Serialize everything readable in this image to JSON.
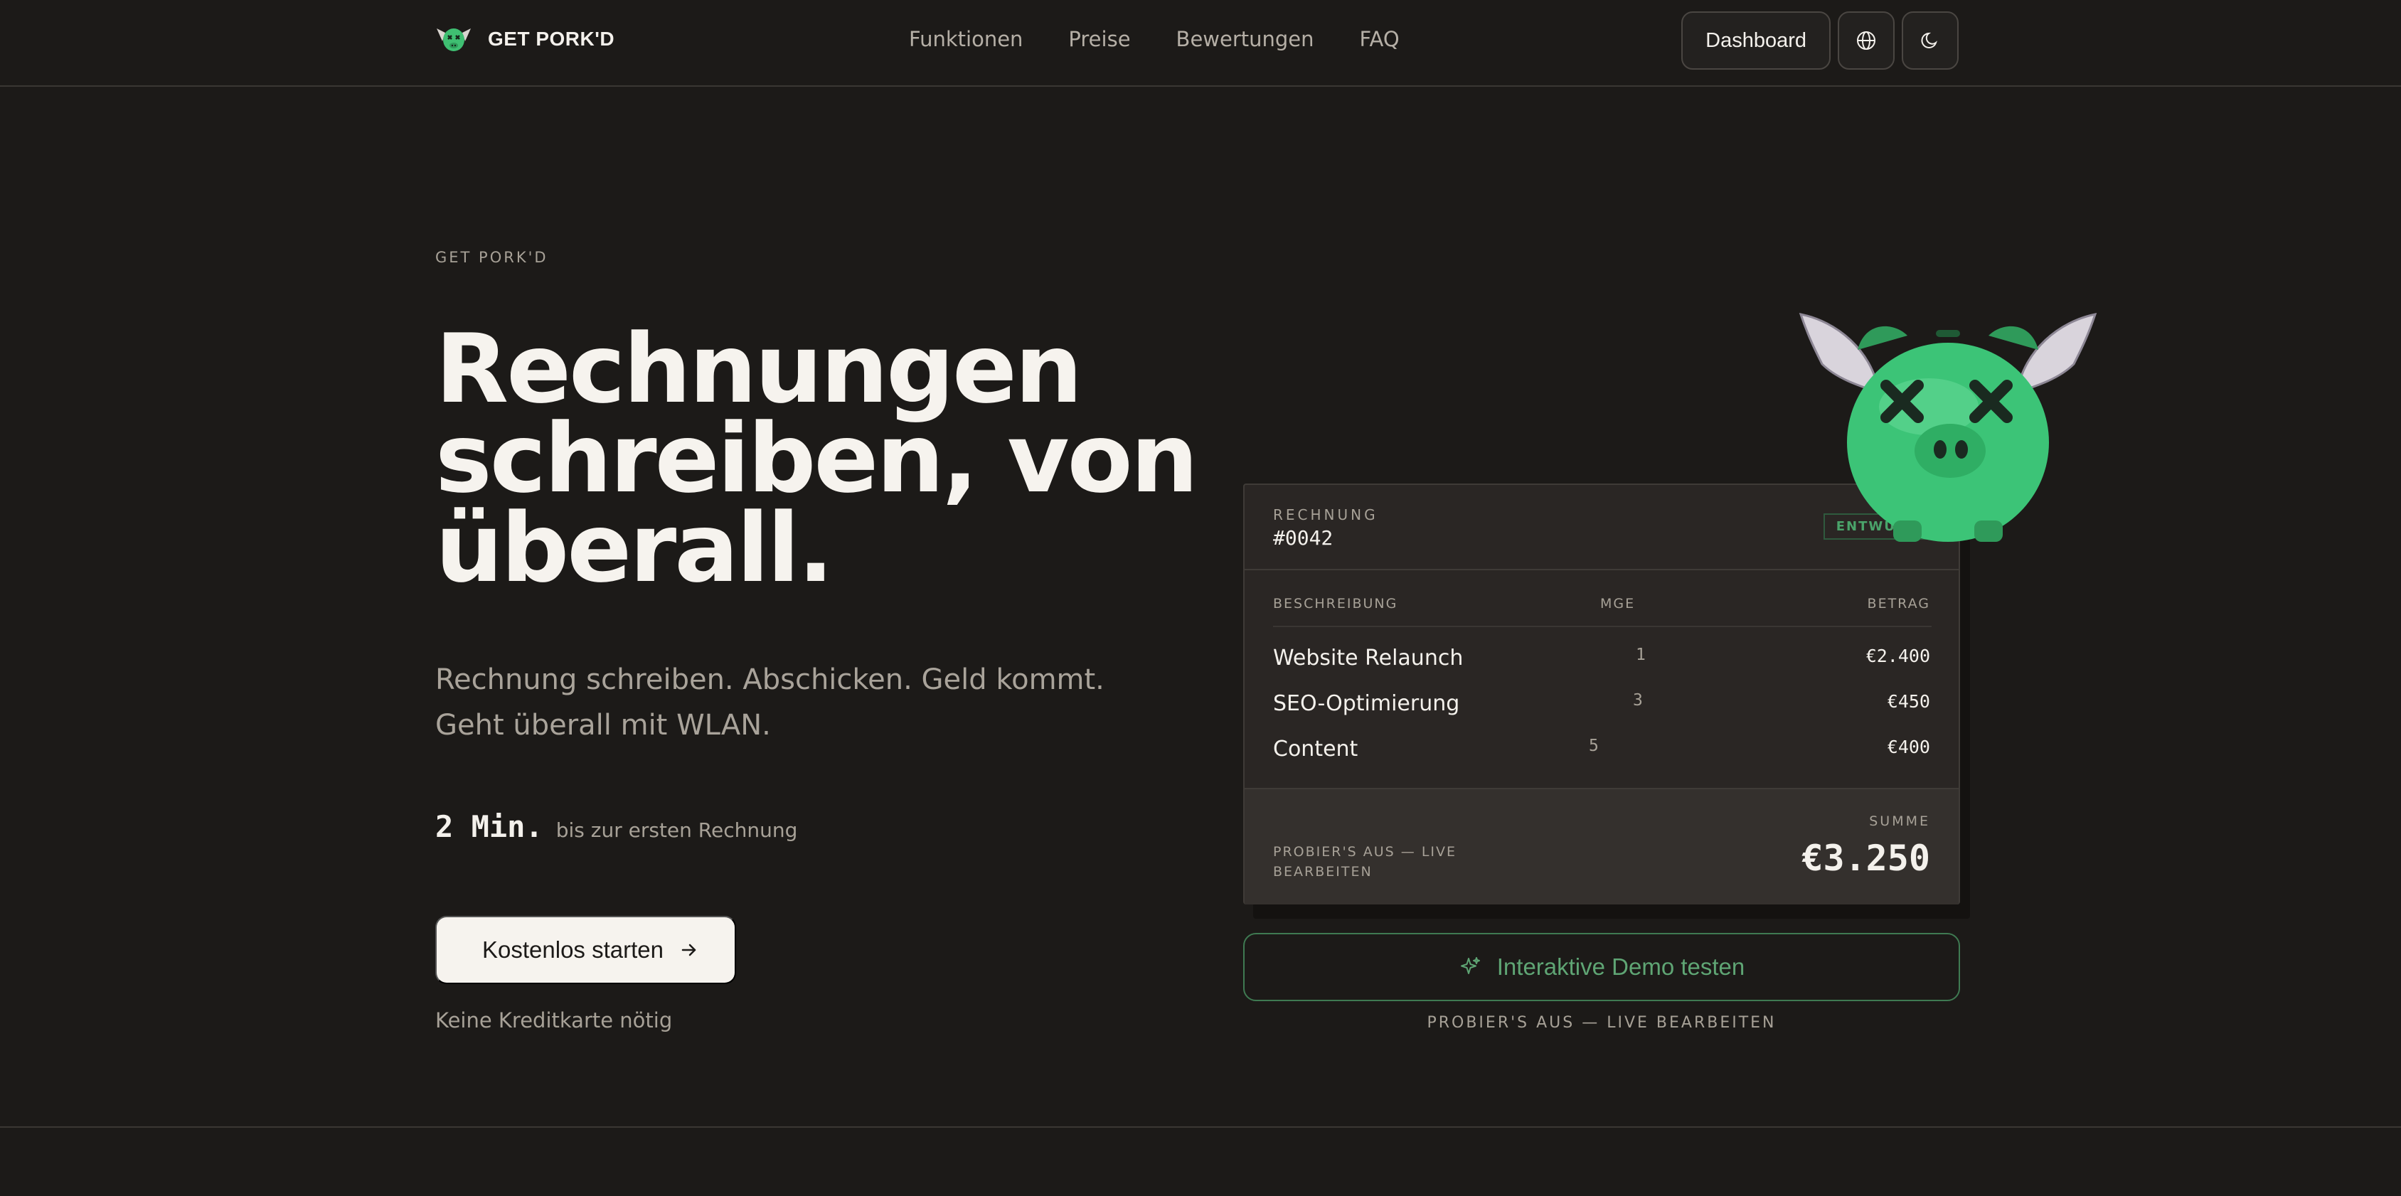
{
  "brand": {
    "name": "GET PORK'D"
  },
  "nav": {
    "links": [
      "Funktionen",
      "Preise",
      "Bewertungen",
      "FAQ"
    ],
    "dashboard_label": "Dashboard"
  },
  "hero": {
    "eyebrow": "GET PORK'D",
    "headline": [
      "Rechnungen",
      "schreiben, von",
      "überall."
    ],
    "subline": [
      "Rechnung schreiben. Abschicken. Geld kommt.",
      "Geht überall mit WLAN."
    ],
    "stat_value": "2 Min.",
    "stat_label": "bis zur ersten Rechnung",
    "cta_label": "Kostenlos starten",
    "note": "Keine Kreditkarte nötig"
  },
  "invoice": {
    "label": "RECHNUNG",
    "number": "#0042",
    "status": "ENTWURF",
    "columns": {
      "description": "BESCHREIBUNG",
      "qty": "MGE",
      "amount": "BETRAG"
    },
    "rows": [
      {
        "description": "Website Relaunch",
        "qty": "1",
        "amount": "€2.400"
      },
      {
        "description": "SEO-Optimierung",
        "qty": "3",
        "amount": "€450"
      },
      {
        "description": "Content",
        "qty": "5",
        "amount": "€400"
      }
    ],
    "footer_hint": "PROBIER'S AUS — LIVE BEARBEITEN",
    "sum_label": "SUMME",
    "sum_value": "€3.250"
  },
  "demo": {
    "button_label": "Interaktive Demo testen",
    "hint": "PROBIER'S AUS — LIVE BEARBEITEN"
  },
  "colors": {
    "background": "#1c1a18",
    "accent_green": "#5fa574",
    "card": "#2a2624",
    "text": "#f4f1ec",
    "muted": "#a7a197"
  }
}
